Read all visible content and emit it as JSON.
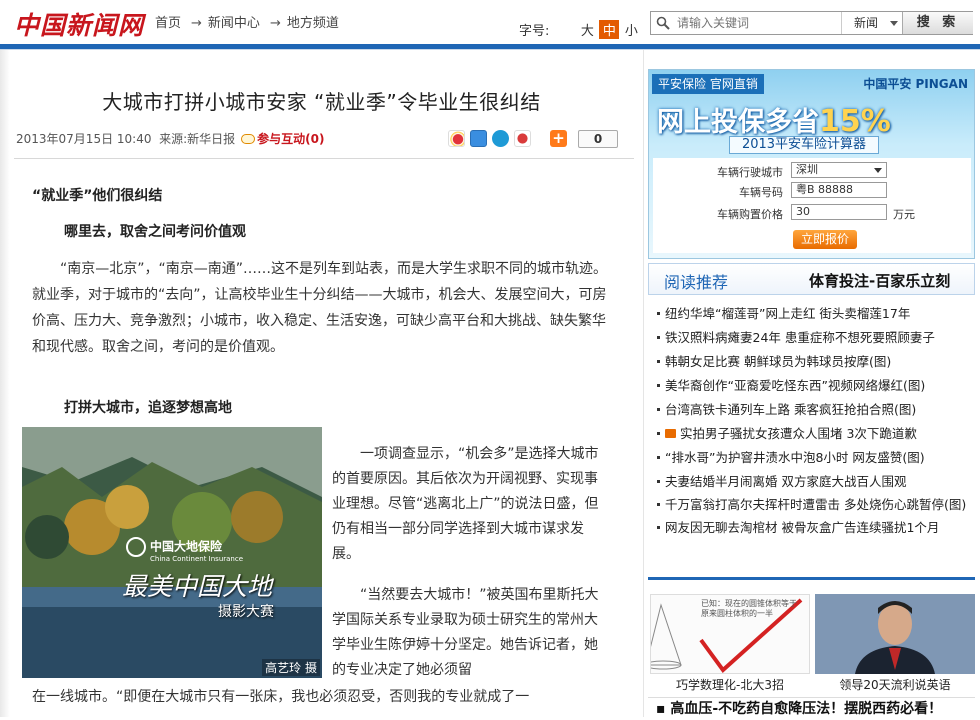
{
  "header": {
    "logo": "中国新闻网",
    "breadcrumb": [
      "首页",
      "新闻中心",
      "地方频道"
    ],
    "breadcrumb_sep": "→",
    "font_size_label": "字号:",
    "font_sizes": [
      "大",
      "中",
      "小"
    ],
    "active_font_size": "中",
    "search_placeholder": "请输入关键词",
    "search_scope": "新闻",
    "search_button": "搜 索"
  },
  "article": {
    "title": "大城市打拼小城市安家 “就业季”令毕业生很纠结",
    "date": "2013年07月15日 10:40",
    "source": "来源:新华日报",
    "interact": "参与互动(0)",
    "share_count": "0",
    "h1": "“就业季”他们很纠结",
    "h2": "哪里去，取舍之间考问价值观",
    "p1": "“南京—北京”，“南京—南通”……这不是列车到站表，而是大学生求职不同的城市轨迹。就业季，对于城市的“去向”，让高校毕业生十分纠结——大城市，机会大、发展空间大，可房价高、压力大、竞争激烈；小城市，收入稳定、生活安逸，可缺少高平台和大挑战、缺失繁华和现代感。取舍之间，考问的是价值观。",
    "h3": "打拼大城市，追逐梦想高地",
    "p2": "一项调查显示，“机会多”是选择大城市的首要原因。其后依次为开阔视野、实现事业理想。尽管“逃离北上广”的说法日盛，但仍有相当一部分同学选择到大城市谋求发展。",
    "p3": "“当然要去大城市！”被英国布里斯托大学国际关系专业录取为硕士研究生的常州大学毕业生陈伊婷十分坚定。她告诉记者，她的专业决定了她必须留",
    "p3b": "在一线城市。“即便在大城市只有一张床，我也必须忍受，否则我的专业就成了一",
    "image": {
      "brand_cn": "中国大地保险",
      "brand_en": "China Continent Insurance",
      "title": "最美中国大地",
      "subtitle": "摄影大赛",
      "credit": "高艺玲 摄"
    }
  },
  "sidebar": {
    "ad": {
      "badge": "平安保险 官网直销",
      "brand": "中国平安 PINGAN",
      "slogan": "网上投保多省",
      "slogan_pct": "15%",
      "calc": "2013平安车险计算器",
      "city_label": "车辆行驶城市",
      "city_value": "深圳",
      "plate_label": "车辆号码",
      "plate_value": "粤B 88888",
      "price_label": "车辆购置价格",
      "price_value": "30",
      "price_unit": "万元",
      "quote_button": "立即报价"
    },
    "tab_recommend": "阅读推荐",
    "tab_sports": "体育投注-百家乐立刻",
    "news": [
      "纽约华埠“榴莲哥”网上走红 街头卖榴莲17年",
      "铁汉照料病瘫妻24年 患重症称不想死要照顾妻子",
      "韩朝女足比赛 朝鲜球员为韩球员按摩(图)",
      "美华裔创作“亚裔爱吃怪东西”视频网络爆红(图)",
      "台湾高铁卡通列车上路 乘客疯狂抢拍合照(图)",
      "实拍男子骚扰女孩遭众人围堵 3次下跪道歉",
      "“排水哥”为护窨井渍水中泡8小时 网友盛赞(图)",
      "夫妻结婚半月闹离婚 双方家庭大战百人围观",
      "千万富翁打高尔夫挥杆时遭雷击 多处烧伤心跳暂停(图)",
      "网友因无聊去淘棺材 被骨灰盒广告连续骚扰1个月"
    ],
    "thumb1_caption": "巧学数理化-北大3招",
    "thumb2_caption": "领导20天流利说英语",
    "thumb1_text": "已知：现在的圆锥体积等于原来圆柱体积的一半",
    "bottom_link": "▪ 高血压-不吃药自愈降压法！摆脱西药必看！"
  }
}
